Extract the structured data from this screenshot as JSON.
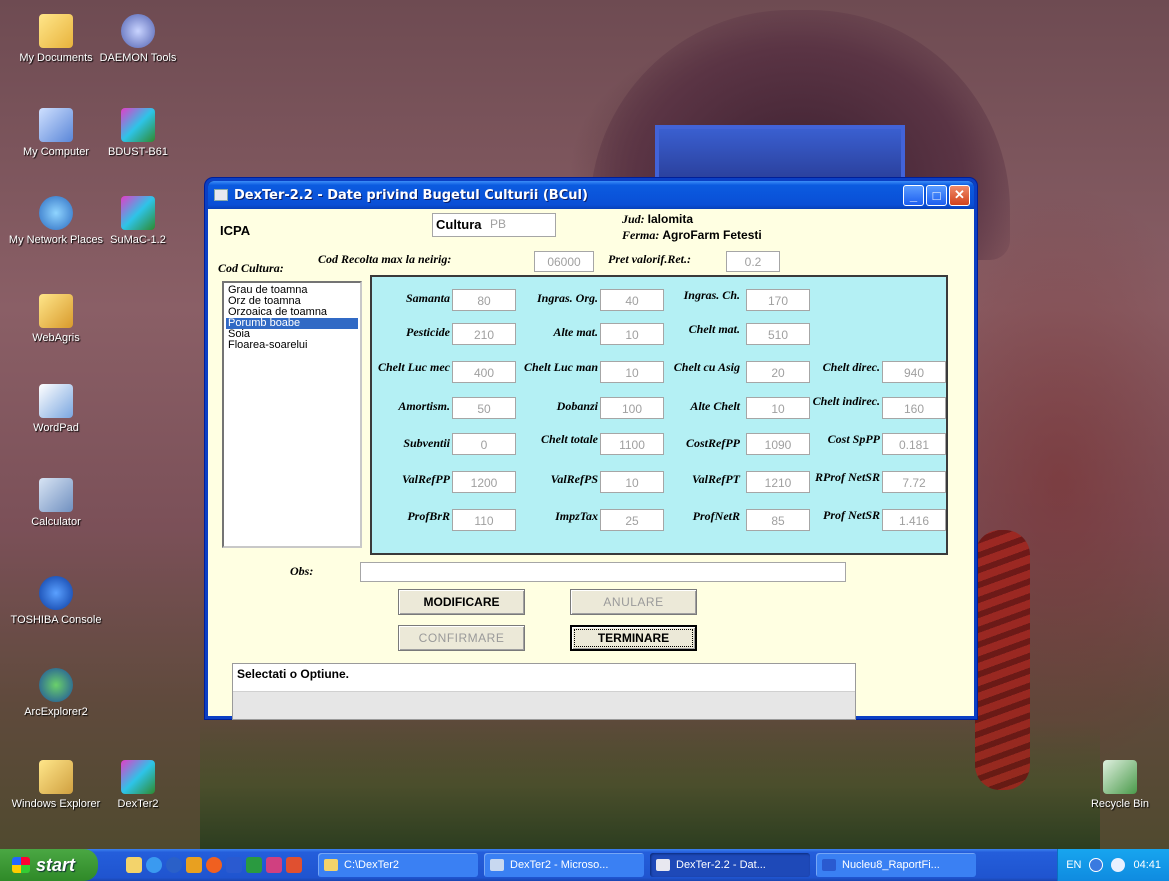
{
  "desktop": {
    "icons": [
      {
        "label": "My Documents"
      },
      {
        "label": "DAEMON Tools"
      },
      {
        "label": "My Computer"
      },
      {
        "label": "BDUST-B61"
      },
      {
        "label": "My Network Places"
      },
      {
        "label": "SuMaC-1.2"
      },
      {
        "label": "WebAgris"
      },
      {
        "label": "WordPad"
      },
      {
        "label": "Calculator"
      },
      {
        "label": "TOSHIBA Console"
      },
      {
        "label": "ArcExplorer2"
      },
      {
        "label": "Windows Explorer"
      },
      {
        "label": "DexTer2"
      },
      {
        "label": "Recycle Bin"
      }
    ]
  },
  "window": {
    "title": "DexTer-2.2  -  Date privind Bugetul Culturii (BCul)",
    "org": "ICPA",
    "cultura_label": "Cultura",
    "cultura_value": "PB",
    "jud_label": "Jud:",
    "jud_value": "Ialomita",
    "ferma_label": "Ferma:",
    "ferma_value": "AgroFarm Fetesti",
    "cod_recolta_label": "Cod Recolta max la neirig:",
    "cod_recolta_value": "06000",
    "pret_label": "Pret valorif.Ret.:",
    "pret_value": "0.2",
    "cod_cultura_label": "Cod Cultura:",
    "culturi": [
      "Grau de toamna",
      "Orz de toamna",
      "Orzoaica de toamna",
      "Porumb boabe",
      "Soia",
      "Floarea-soarelui"
    ],
    "selected_cultura": "Porumb boabe",
    "fields": {
      "samanta": {
        "label": "Samanta",
        "value": "80"
      },
      "ingras_org": {
        "label": "Ingras. Org.",
        "value": "40"
      },
      "ingras_ch": {
        "label": "Ingras. Ch.",
        "value": "170"
      },
      "pesticide": {
        "label": "Pesticide",
        "value": "210"
      },
      "alte_mat": {
        "label": "Alte mat.",
        "value": "10"
      },
      "chelt_mat": {
        "label": "Chelt mat.",
        "value": "510"
      },
      "chelt_luc_mec": {
        "label": "Chelt Luc mec",
        "value": "400"
      },
      "chelt_luc_man": {
        "label": "Chelt Luc man",
        "value": "10"
      },
      "chelt_cu_asig": {
        "label": "Chelt cu Asig",
        "value": "20"
      },
      "chelt_direc": {
        "label": "Chelt direc.",
        "value": "940"
      },
      "amortism": {
        "label": "Amortism.",
        "value": "50"
      },
      "dobanzi": {
        "label": "Dobanzi",
        "value": "100"
      },
      "alte_chelt": {
        "label": "Alte Chelt",
        "value": "10"
      },
      "chelt_indirec": {
        "label": "Chelt indirec.",
        "value": "160"
      },
      "subventii": {
        "label": "Subventii",
        "value": "0"
      },
      "chelt_totale": {
        "label": "Chelt totale",
        "value": "1100"
      },
      "cost_ref_pp": {
        "label": "CostRefPP",
        "value": "1090"
      },
      "cost_sp_pp": {
        "label": "Cost SpPP",
        "value": "0.181"
      },
      "val_ref_pp": {
        "label": "ValRefPP",
        "value": "1200"
      },
      "val_ref_ps": {
        "label": "ValRefPS",
        "value": "10"
      },
      "val_ref_pt": {
        "label": "ValRefPT",
        "value": "1210"
      },
      "r_prof_net_sr": {
        "label": "RProf NetSR",
        "value": "7.72"
      },
      "prof_br_r": {
        "label": "ProfBrR",
        "value": "110"
      },
      "impz_tax": {
        "label": "ImpzTax",
        "value": "25"
      },
      "prof_net_r": {
        "label": "ProfNetR",
        "value": "85"
      },
      "prof_net_sr": {
        "label": "Prof NetSR",
        "value": "1.416"
      }
    },
    "obs_label": "Obs:",
    "obs_value": "",
    "buttons": {
      "modificare": "MODIFICARE",
      "anulare": "ANULARE",
      "confirmare": "CONFIRMARE",
      "terminare": "TERMINARE"
    },
    "status": "Selectati o Optiune."
  },
  "taskbar": {
    "start": "start",
    "tasks": [
      "C:\\DexTer2",
      "DexTer2 - Microso...",
      "DexTer-2.2 - Dat...",
      "Nucleu8_RaportFi..."
    ],
    "lang": "EN",
    "clock": "04:41"
  }
}
